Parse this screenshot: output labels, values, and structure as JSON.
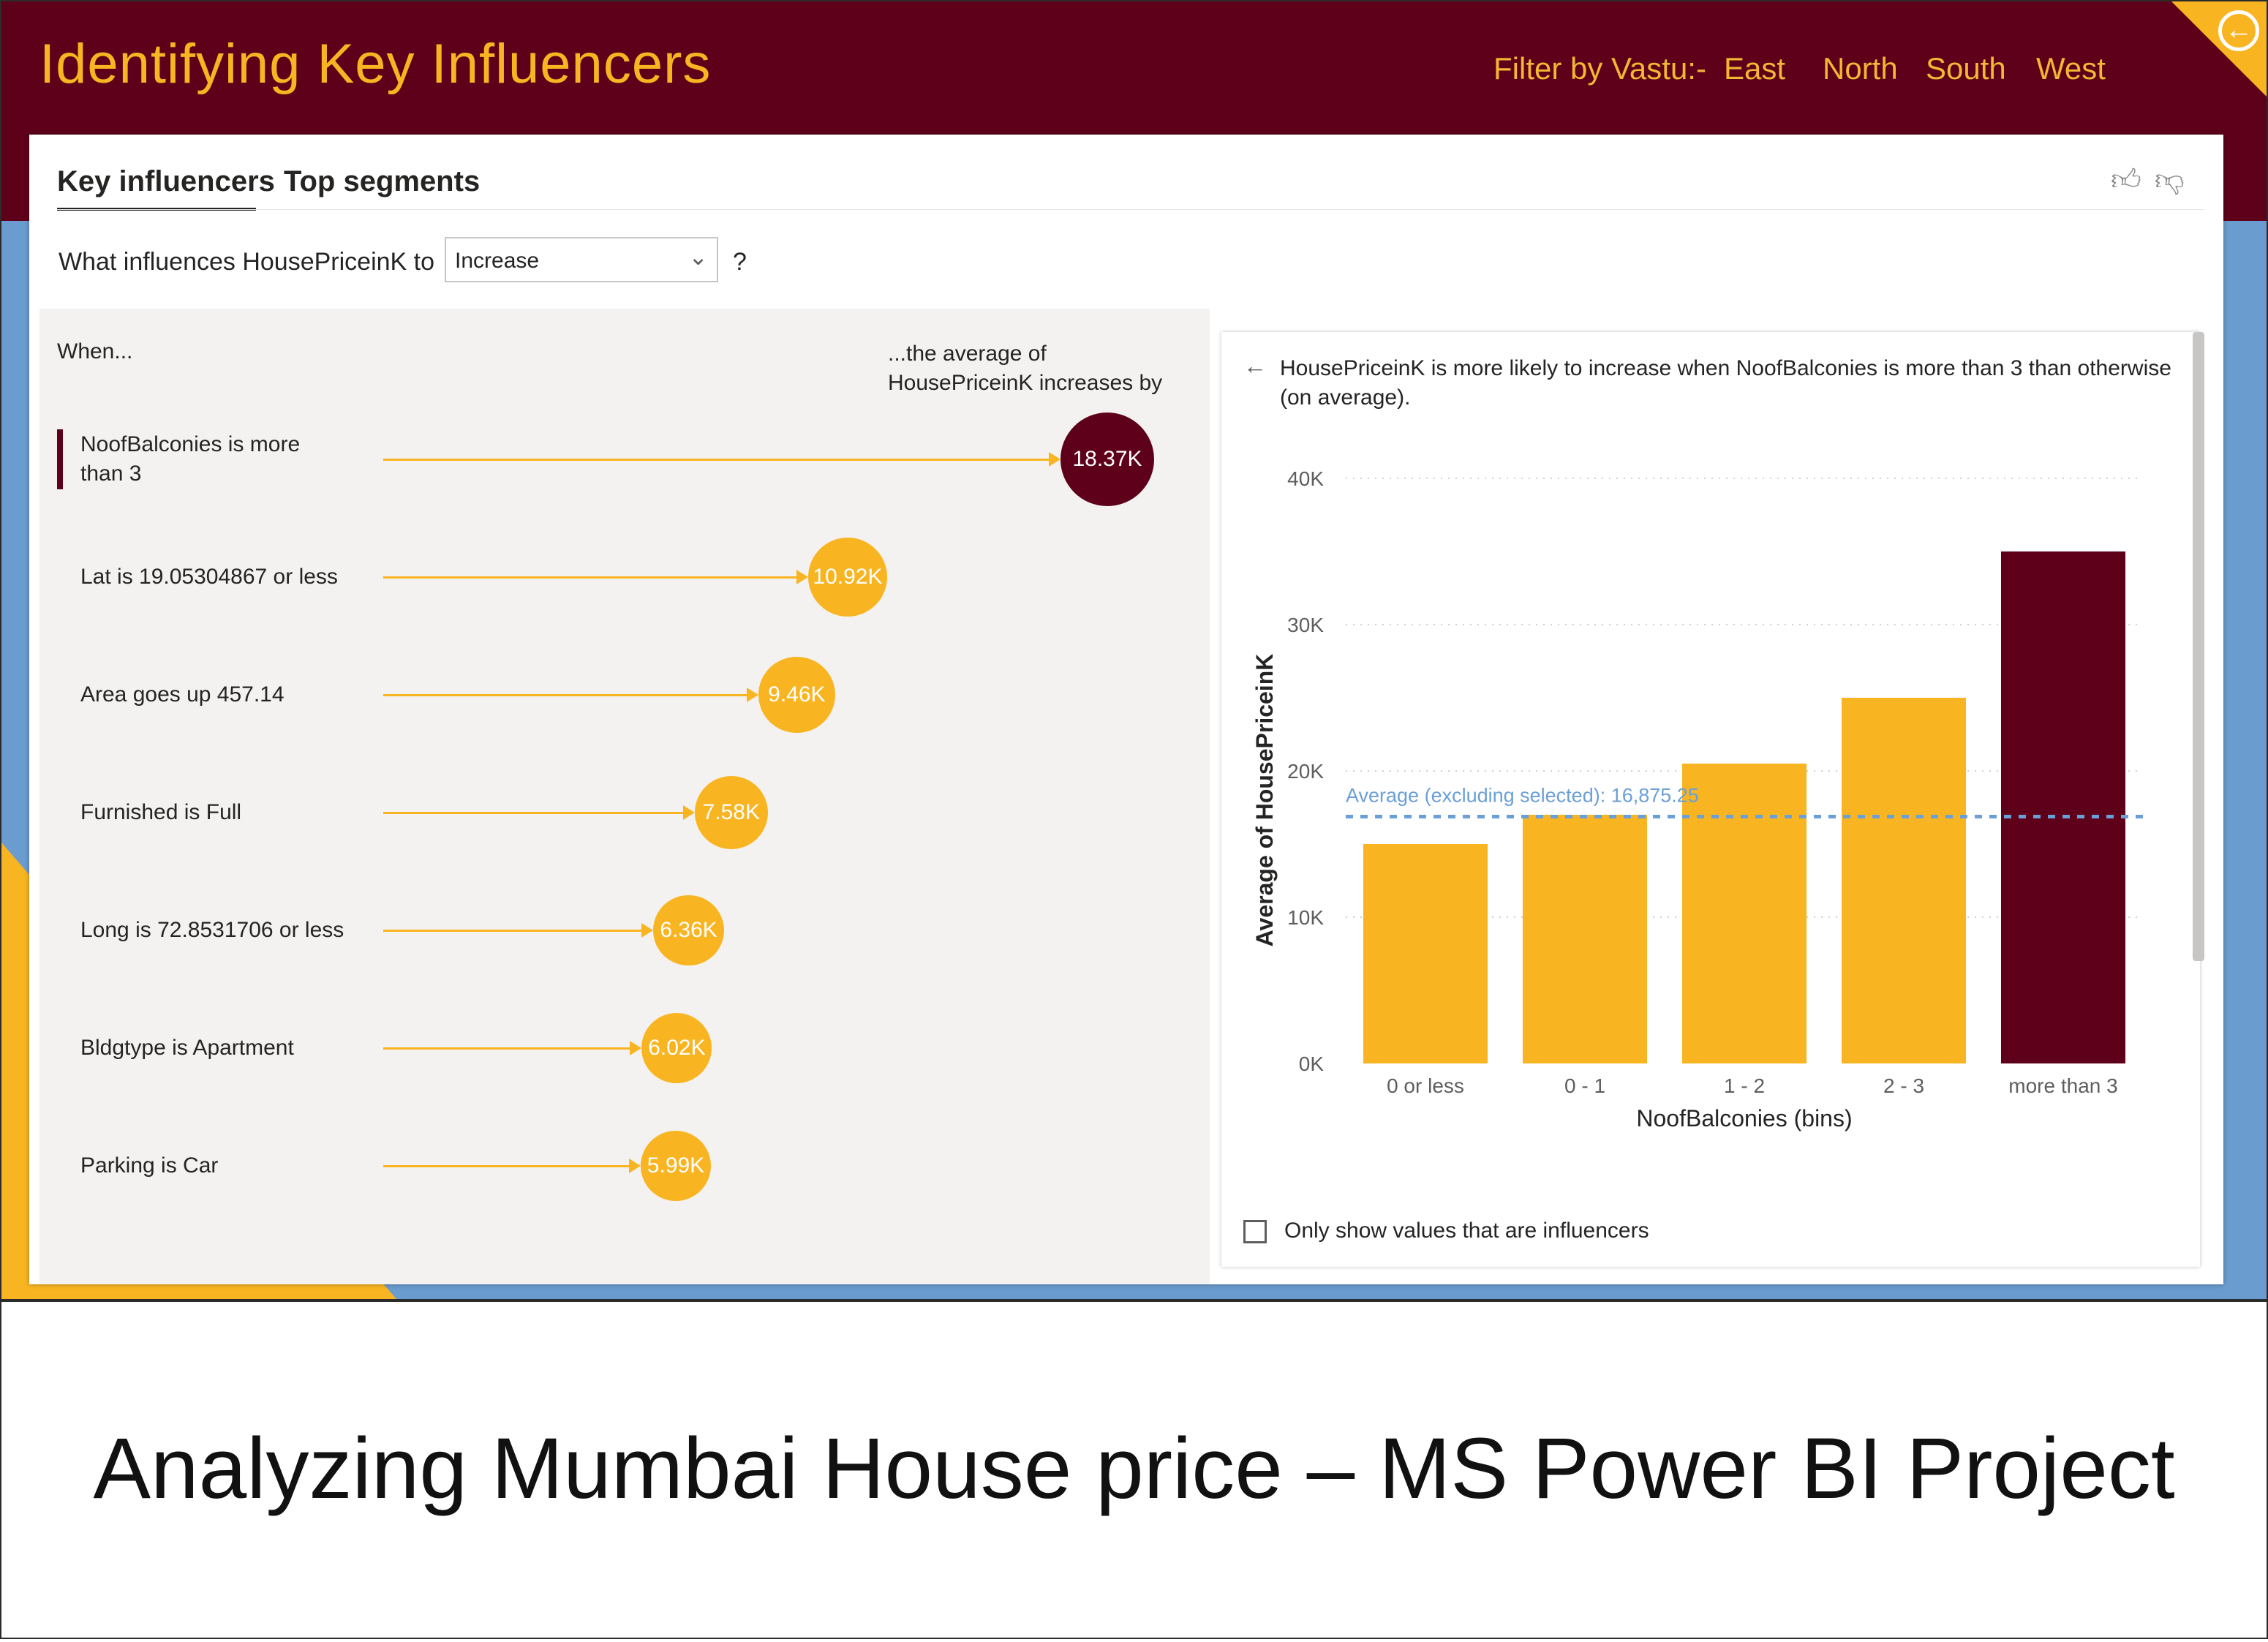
{
  "header": {
    "title": "Identifying Key Influencers",
    "filter_label": "Filter by Vastu:-",
    "filters": [
      "East",
      "North",
      "South",
      "West"
    ]
  },
  "tabs": [
    "Key influencers",
    "Top segments"
  ],
  "query": {
    "text": "What influences HousePriceinK to",
    "dropdown_value": "Increase",
    "help": "?"
  },
  "influencers_panel": {
    "when_label": "When...",
    "avg_label_line1": "...the average of",
    "avg_label_line2": "HousePriceinK increases by",
    "items": [
      {
        "label_line1": "NoofBalconies is more",
        "label_line2": "than 3",
        "value": "18.37K",
        "amount": 18.37,
        "selected": true
      },
      {
        "label_line1": "Lat is 19.05304867 or less",
        "label_line2": "",
        "value": "10.92K",
        "amount": 10.92,
        "selected": false
      },
      {
        "label_line1": "Area goes up 457.14",
        "label_line2": "",
        "value": "9.46K",
        "amount": 9.46,
        "selected": false
      },
      {
        "label_line1": "Furnished is Full",
        "label_line2": "",
        "value": "7.58K",
        "amount": 7.58,
        "selected": false
      },
      {
        "label_line1": "Long is 72.8531706 or less",
        "label_line2": "",
        "value": "6.36K",
        "amount": 6.36,
        "selected": false
      },
      {
        "label_line1": "Bldgtype is Apartment",
        "label_line2": "",
        "value": "6.02K",
        "amount": 6.02,
        "selected": false
      },
      {
        "label_line1": "Parking is Car",
        "label_line2": "",
        "value": "5.99K",
        "amount": 5.99,
        "selected": false
      }
    ]
  },
  "detail_panel": {
    "back_arrow": "←",
    "description": "HousePriceinK is more likely to increase when NoofBalconies is more than 3 than otherwise (on average).",
    "checkbox_label": "Only show values that are influencers",
    "checkbox_checked": false
  },
  "chart_data": {
    "type": "bar",
    "categories": [
      "0 or less",
      "0 - 1",
      "1 - 2",
      "2 - 3",
      "more than 3"
    ],
    "values": [
      15000,
      17000,
      20500,
      25000,
      35000
    ],
    "highlight_index": 4,
    "xlabel": "NoofBalconies (bins)",
    "ylabel": "Average of HousePriceinK",
    "ylim": [
      0,
      40000
    ],
    "yticks": [
      0,
      10000,
      20000,
      30000,
      40000
    ],
    "ytick_labels": [
      "0K",
      "10K",
      "20K",
      "30K",
      "40K"
    ],
    "reference_line": {
      "value": 16875.25,
      "label": "Average (excluding selected): 16,875.25"
    },
    "grid": true,
    "colors": {
      "bar": "#f9b521",
      "highlight": "#5e0019",
      "reference": "#6a9fd8"
    }
  },
  "caption": "Analyzing Mumbai House price – MS Power BI Project",
  "colors": {
    "maroon": "#5e0019",
    "gold": "#f9b521",
    "blue": "#6a9cd0"
  }
}
